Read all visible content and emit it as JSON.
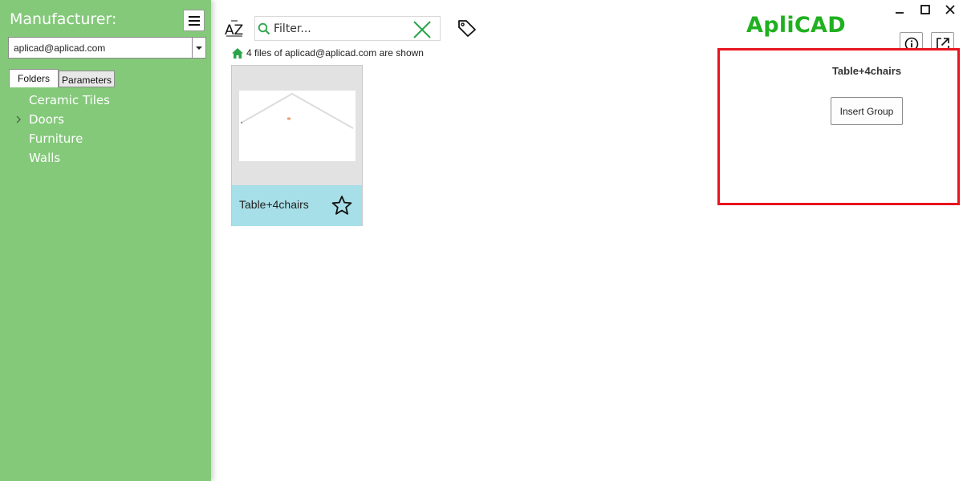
{
  "sidebar": {
    "title": "Manufacturer:",
    "manufacturer_value": "aplicad@aplicad.com",
    "tabs": [
      {
        "label": "Folders",
        "active": true
      },
      {
        "label": "Parameters",
        "active": false
      }
    ],
    "tree_items": [
      {
        "label": "Ceramic Tiles",
        "expandable": false
      },
      {
        "label": "Doors",
        "expandable": true
      },
      {
        "label": "Furniture",
        "expandable": false
      },
      {
        "label": "Walls",
        "expandable": false
      }
    ],
    "menu_icon": "hamburger-icon",
    "background_color": "#84c97a"
  },
  "toolbar": {
    "sort_icon": "sort-az-icon",
    "filter_placeholder": "Filter...",
    "tag_icon": "tag-icon",
    "clear_icon": "clear-x-icon",
    "accent_color": "#2aa44a"
  },
  "status": {
    "text": "4 files of aplicad@aplicad.com are shown",
    "icon": "home-icon"
  },
  "cards": [
    {
      "name": "Table+4chairs",
      "favorite_icon": "star-outline-icon",
      "footer_color": "#a7dfe8"
    }
  ],
  "header": {
    "logo": "ApliCAD",
    "logo_color": "#20b020",
    "info_icon": "info-icon",
    "external_icon": "open-external-icon",
    "window_controls": [
      "minimize-icon",
      "maximize-icon",
      "close-icon"
    ]
  },
  "details": {
    "title": "Table+4chairs",
    "insert_button_label": "Insert Group",
    "highlight_color": "#e8141e"
  }
}
